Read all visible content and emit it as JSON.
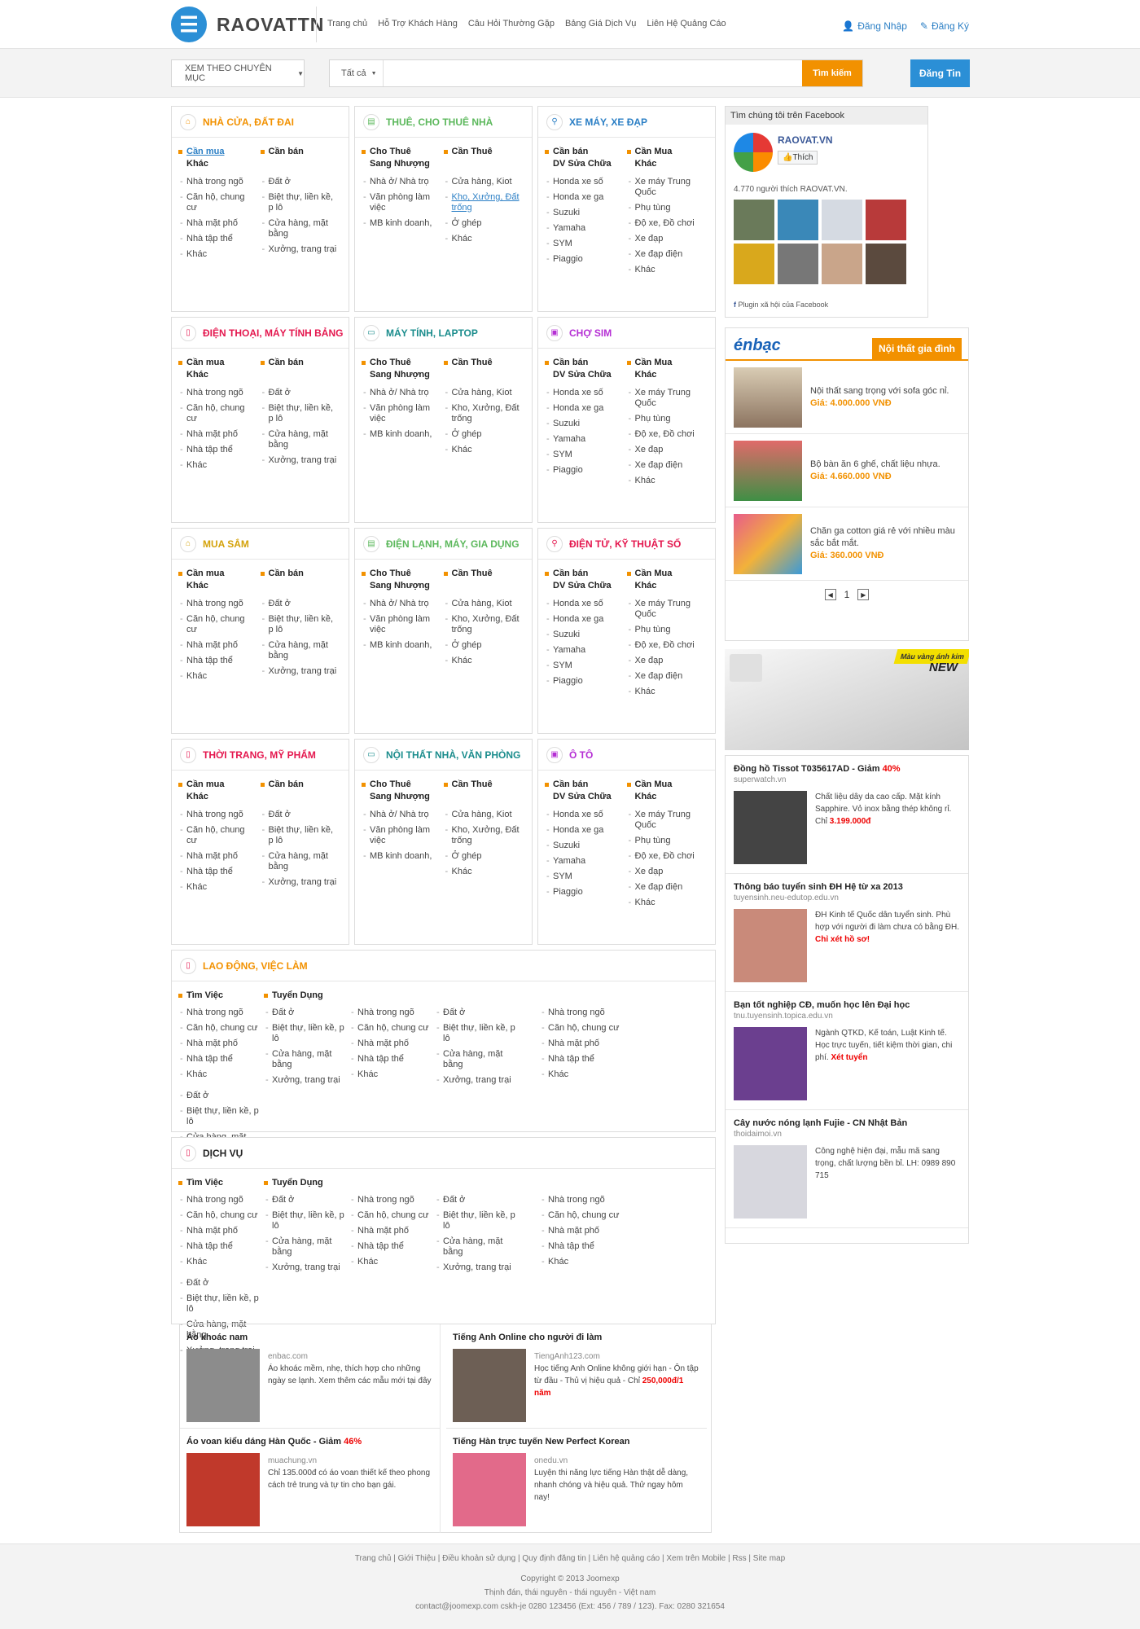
{
  "header": {
    "logo": "RAOVATTN",
    "logo_icon": "menu-icon",
    "nav": [
      "Trang chủ",
      "Hỗ Trợ Khách Hàng",
      "Câu Hỏi Thường Gặp",
      "Bảng Giá Dịch Vụ",
      "Liên Hệ Quảng Cáo"
    ],
    "login": "Đăng Nhập",
    "register": "Đăng Ký"
  },
  "search": {
    "category_dropdown": "XEM THEO CHUYÊN MỤC",
    "scope": "Tất cả",
    "placeholder": "",
    "button": "Tìm kiếm",
    "post_button": "Đăng Tin"
  },
  "categories": [
    {
      "title": "NHÀ CỬA, ĐẤT ĐAI",
      "color": "#f29100",
      "icon": "home-icon",
      "col1_head": "Cần mua",
      "col1_sub": "Khác",
      "col1": [
        "Nhà trong ngõ",
        "Căn hộ, chung cư",
        "Nhà mặt phố",
        "Nhà tập thể",
        "Khác"
      ],
      "col2_head": "Cần bán",
      "col2_sub": "",
      "col2": [
        "Đất ở",
        "Biệt thự, liền kề, p lô",
        "Cửa hàng, mặt bằng",
        "Xưởng, trang trại"
      ]
    },
    {
      "title": "THUÊ, CHO THUÊ NHÀ",
      "color": "#5cb85c",
      "icon": "building-icon",
      "col1_head": "Cho Thuê",
      "col1_sub": "Sang Nhượng",
      "col1": [
        "Nhà ở/ Nhà trọ",
        "Văn phòng làm việc",
        "MB kinh doanh,"
      ],
      "col2_head": "Cần Thuê",
      "col2_sub": "",
      "col2": [
        "Cửa hàng, Kiot",
        "Kho, Xưởng, Đất trống",
        "Ở ghép",
        "Khác"
      ]
    },
    {
      "title": "XE MÁY, XE ĐẠP",
      "color": "#2b7fc5",
      "icon": "bike-icon",
      "col1_head": "Cần bán",
      "col1_sub": "DV Sửa Chữa",
      "col1": [
        "Honda xe số",
        "Honda xe ga",
        "Suzuki",
        "Yamaha",
        "SYM",
        "Piaggio"
      ],
      "col2_head": "Cần Mua",
      "col2_sub": "Khác",
      "col2": [
        "Xe máy Trung Quốc",
        "Phụ tùng",
        "Độ xe, Đồ chơi",
        "Xe đạp",
        "Xe đạp điện",
        "Khác"
      ]
    },
    {
      "title": "ĐIỆN THOẠI, MÁY TÍNH BẢNG",
      "color": "#e4174e",
      "icon": "phone-icon",
      "col1_head": "Cần mua",
      "col1_sub": "Khác",
      "col1": [
        "Nhà trong ngõ",
        "Căn hộ, chung cư",
        "Nhà mặt phố",
        "Nhà tập thể",
        "Khác"
      ],
      "col2_head": "Cần bán",
      "col2_sub": "",
      "col2": [
        "Đất ở",
        "Biệt thự, liền kề, p lô",
        "Cửa hàng, mặt bằng",
        "Xưởng, trang trại"
      ]
    },
    {
      "title": "MÁY TÍNH, LAPTOP",
      "color": "#1a8c8c",
      "icon": "laptop-icon",
      "col1_head": "Cho Thuê",
      "col1_sub": "Sang Nhượng",
      "col1": [
        "Nhà ở/ Nhà trọ",
        "Văn phòng làm việc",
        "MB kinh doanh,"
      ],
      "col2_head": "Cần Thuê",
      "col2_sub": "",
      "col2": [
        "Cửa hàng, Kiot",
        "Kho, Xưởng, Đất trống",
        "Ở ghép",
        "Khác"
      ]
    },
    {
      "title": "CHỢ SIM",
      "color": "#b52fd4",
      "icon": "sim-icon",
      "col1_head": "Cần bán",
      "col1_sub": "DV Sửa Chữa",
      "col1": [
        "Honda xe số",
        "Honda xe ga",
        "Suzuki",
        "Yamaha",
        "SYM",
        "Piaggio"
      ],
      "col2_head": "Cần Mua",
      "col2_sub": "Khác",
      "col2": [
        "Xe máy Trung Quốc",
        "Phụ tùng",
        "Độ xe, Đồ chơi",
        "Xe đạp",
        "Xe đạp điện",
        "Khác"
      ]
    },
    {
      "title": "MUA SẮM",
      "color": "#d4a20a",
      "icon": "home-icon",
      "col1_head": "Cần mua",
      "col1_sub": "Khác",
      "col1": [
        "Nhà trong ngõ",
        "Căn hộ, chung cư",
        "Nhà mặt phố",
        "Nhà tập thể",
        "Khác"
      ],
      "col2_head": "Cần bán",
      "col2_sub": "",
      "col2": [
        "Đất ở",
        "Biệt thự, liền kề, p lô",
        "Cửa hàng, mặt bằng",
        "Xưởng, trang trại"
      ]
    },
    {
      "title": "ĐIỆN LẠNH, MÁY, GIA DỤNG",
      "color": "#5cb85c",
      "icon": "building-icon",
      "col1_head": "Cho Thuê",
      "col1_sub": "Sang Nhượng",
      "col1": [
        "Nhà ở/ Nhà trọ",
        "Văn phòng làm việc",
        "MB kinh doanh,"
      ],
      "col2_head": "Cần Thuê",
      "col2_sub": "",
      "col2": [
        "Cửa hàng, Kiot",
        "Kho, Xưởng, Đất trống",
        "Ở ghép",
        "Khác"
      ]
    },
    {
      "title": "ĐIỆN TỬ, KỸ THUẬT SỐ",
      "color": "#e4174e",
      "icon": "bike-icon",
      "col1_head": "Cần bán",
      "col1_sub": "DV Sửa Chữa",
      "col1": [
        "Honda xe số",
        "Honda xe ga",
        "Suzuki",
        "Yamaha",
        "SYM",
        "Piaggio"
      ],
      "col2_head": "Cần Mua",
      "col2_sub": "Khác",
      "col2": [
        "Xe máy Trung Quốc",
        "Phụ tùng",
        "Độ xe, Đồ chơi",
        "Xe đạp",
        "Xe đạp điện",
        "Khác"
      ]
    },
    {
      "title": "THỜI TRANG, MỸ PHẨM",
      "color": "#e4174e",
      "icon": "phone-icon",
      "col1_head": "Cần mua",
      "col1_sub": "Khác",
      "col1": [
        "Nhà trong ngõ",
        "Căn hộ, chung cư",
        "Nhà mặt phố",
        "Nhà tập thể",
        "Khác"
      ],
      "col2_head": "Cần bán",
      "col2_sub": "",
      "col2": [
        "Đất ở",
        "Biệt thự, liền kề, p lô",
        "Cửa hàng, mặt bằng",
        "Xưởng, trang trại"
      ]
    },
    {
      "title": "NỘI THẤT NHÀ, VĂN PHÒNG",
      "color": "#1a8c8c",
      "icon": "laptop-icon",
      "col1_head": "Cho Thuê",
      "col1_sub": "Sang Nhượng",
      "col1": [
        "Nhà ở/ Nhà trọ",
        "Văn phòng làm việc",
        "MB kinh doanh,"
      ],
      "col2_head": "Cần Thuê",
      "col2_sub": "",
      "col2": [
        "Cửa hàng, Kiot",
        "Kho, Xưởng, Đất trống",
        "Ở ghép",
        "Khác"
      ]
    },
    {
      "title": "Ô TÔ",
      "color": "#b52fd4",
      "icon": "sim-icon",
      "col1_head": "Cần bán",
      "col1_sub": "DV Sửa Chữa",
      "col1": [
        "Honda xe số",
        "Honda xe ga",
        "Suzuki",
        "Yamaha",
        "SYM",
        "Piaggio"
      ],
      "col2_head": "Cần Mua",
      "col2_sub": "Khác",
      "col2": [
        "Xe máy Trung Quốc",
        "Phụ tùng",
        "Độ xe, Đồ chơi",
        "Xe đạp",
        "Xe đạp điện",
        "Khác"
      ]
    }
  ],
  "wide": [
    {
      "title": "LAO ĐỘNG, VIỆC LÀM",
      "color": "#f29100",
      "icon": "phone-icon",
      "head1": "Tìm Việc",
      "head2": "Tuyển Dụng",
      "colA": [
        "Nhà trong ngõ",
        "Căn hộ, chung cư",
        "Nhà mặt phố",
        "Nhà tập thể",
        "Khác"
      ],
      "colB": [
        "Đất ở",
        "Biệt thự, liền kề, p lô",
        "Cửa hàng, mặt bằng",
        "Xưởng, trang trại"
      ]
    },
    {
      "title": "DỊCH VỤ",
      "color": "#222",
      "icon": "phone-icon",
      "head1": "Tìm Việc",
      "head2": "Tuyển Dụng",
      "colA": [
        "Nhà trong ngõ",
        "Căn hộ, chung cư",
        "Nhà mặt phố",
        "Nhà tập thể",
        "Khác"
      ],
      "colB": [
        "Đất ở",
        "Biệt thự, liền kề, p lô",
        "Cửa hàng, mặt bằng",
        "Xưởng, trang trại"
      ]
    }
  ],
  "facebook": {
    "header": "Tìm chúng tôi trên Facebook",
    "page_name": "RAOVAT.VN",
    "like": "Thích",
    "count_text": "4.770 người thích RAOVAT.VN.",
    "plugin": "Plugin xã hội của Facebook"
  },
  "enbac": {
    "logo": "énbạc",
    "tab": "Nội thất gia đình",
    "products": [
      {
        "name": "Nội thất sang trọng với sofa góc nỉ.",
        "price": "Giá: 4.000.000 VNĐ"
      },
      {
        "name": "Bộ bàn ăn 6 ghế, chất liệu nhựa.",
        "price": "Giá: 4.660.000 VNĐ"
      },
      {
        "name": "Chăn ga cotton giá rẻ với nhiều màu sắc bắt mắt.",
        "price": "Giá: 360.000 VNĐ"
      }
    ],
    "page": "1"
  },
  "banner": {
    "tag": "Màu vàng ánh kim",
    "new": "NEW"
  },
  "side_ads": [
    {
      "title": "Đồng hồ Tissot T035617AD - Giảm ",
      "hl": "40%",
      "url": "superwatch.vn",
      "desc": "Chất liệu dây da cao cấp. Mặt kính Sapphire. Vỏ inox bằng thép không rỉ. Chỉ ",
      "price": "3.199.000đ"
    },
    {
      "title": "Thông báo tuyển sinh ĐH Hệ từ xa 2013",
      "hl": "",
      "url": "tuyensinh.neu-edutop.edu.vn",
      "desc": "ĐH Kinh tế Quốc dân tuyển sinh. Phù hợp với người đi làm chưa có bằng ĐH. ",
      "price": "Chỉ xét hồ sơ!"
    },
    {
      "title": "Bạn tốt nghiệp CĐ, muốn học lên Đại học",
      "hl": "",
      "url": "tnu.tuyensinh.topica.edu.vn",
      "desc": "Ngành QTKD, Kế toán, Luật Kinh tế. Học trực tuyến, tiết kiệm thời gian, chi phí. ",
      "price": "Xét tuyển"
    },
    {
      "title": "Cây nước nóng lạnh Fujie - CN Nhật Bản",
      "hl": "",
      "url": "thoidaimoi.vn",
      "desc": "Công nghệ hiện đại, mẫu mã sang trọng, chất lượng bền bỉ. LH: 0989 890 715",
      "price": ""
    }
  ],
  "bottom_ads": [
    {
      "title": "Áo khoác nam",
      "hl": "",
      "url": "enbac.com",
      "desc": "Áo khoác mềm, nhẹ, thích hợp cho những ngày se lạnh. Xem thêm các mẫu mới tại đây",
      "price": ""
    },
    {
      "title": "Tiếng Anh Online cho người đi làm",
      "hl": "",
      "url": "TiengAnh123.com",
      "desc": "Học tiếng Anh Online không giới hạn - Ôn tập từ đầu - Thủ vị hiệu quả - Chỉ ",
      "price": "250,000đ/1 năm"
    },
    {
      "title": "Áo voan kiểu dáng Hàn Quốc - Giảm ",
      "hl": "46%",
      "url": "muachung.vn",
      "desc": "Chỉ 135.000đ có áo voan thiết kế theo phong cách trẻ trung và tự tin cho bạn gái.",
      "price": ""
    },
    {
      "title": "Tiếng Hàn trực tuyến New Perfect Korean",
      "hl": "",
      "url": "onedu.vn",
      "desc": "Luyện thi năng lực tiếng Hàn thật dễ dàng, nhanh chóng và hiệu quả. Thử ngay hôm nay!",
      "price": ""
    }
  ],
  "footer": {
    "links": "Trang chủ | Giới Thiệu | Điều khoản sử dụng | Quy định đăng tin | Liên hệ quảng cáo | Xem trên Mobile | Rss | Site map",
    "copyright": "Copyright © 2013 Joomexp",
    "address": "Thịnh đán, thái nguyên - thái nguyên - Việt nam",
    "contact": "contact@joomexp.com   cskh-je   0280 123456 (Ext: 456 / 789 / 123). Fax: 0280 321654"
  }
}
